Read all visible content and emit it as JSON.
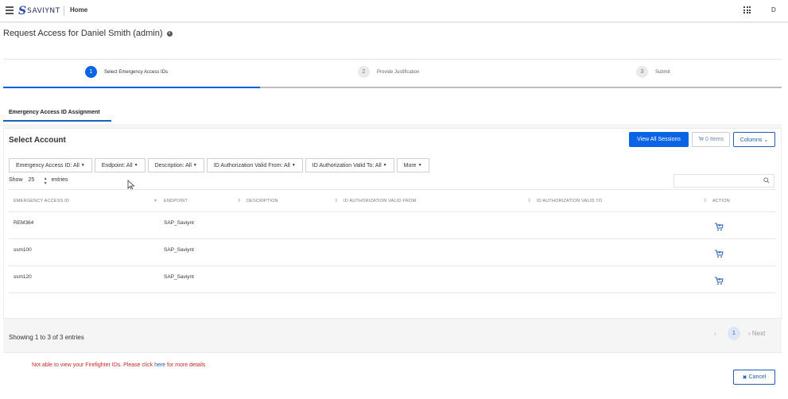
{
  "topbar": {
    "logo_mark": "S",
    "logo_text": "SAVIYNT",
    "home_label": "Home",
    "user_initial": "D"
  },
  "page": {
    "title": "Request Access for Daniel Smith (admin)",
    "info_glyph": "i"
  },
  "steps": [
    {
      "num": "1",
      "label": "Select Emergency Access IDs",
      "active": true
    },
    {
      "num": "2",
      "label": "Provide Justification",
      "active": false
    },
    {
      "num": "3",
      "label": "Submit",
      "active": false
    }
  ],
  "tab": {
    "label": "Emergency Access ID Assignment"
  },
  "panel": {
    "heading": "Select Account",
    "view_sessions_label": "View All Sessions",
    "items_label": "0 Items",
    "columns_label": "Columns ⌄"
  },
  "filters": [
    "Emergency Access ID: All",
    "Endpoint: All",
    "Description: All",
    "ID Authorization Valid From: All",
    "ID Authorization Valid To: All",
    "More"
  ],
  "length_control": {
    "show_label": "Show",
    "value": "25",
    "entries_label": "entries"
  },
  "table": {
    "columns": [
      "EMERGENCY ACCESS ID",
      "ENDPOINT",
      "DESCRIPTION",
      "ID AUTHORIZATION VALID FROM",
      "ID AUTHORIZATION VALID TO",
      "ACTION"
    ],
    "rows": [
      {
        "id": "REM364",
        "endpoint": "SAP_Saviynt"
      },
      {
        "id": "ssm100",
        "endpoint": "SAP_Saviynt"
      },
      {
        "id": "ssm120",
        "endpoint": "SAP_Saviynt"
      }
    ]
  },
  "pagination": {
    "info": "Showing 1 to 3 of 3 entries",
    "prev": "‹",
    "current_page": "1",
    "next": "› Next"
  },
  "footer": {
    "warning_prefix": "Not able to view your Firefighter IDs. Please click ",
    "warning_link": "here",
    "warning_suffix": " for more details",
    "cancel_label": "Cancel"
  },
  "colors": {
    "primary": "#0b63e5",
    "link": "#1f5db4",
    "warning": "#c62828"
  },
  "icons": [
    "menu-icon",
    "apps-grid-icon",
    "info-icon",
    "cart-icon",
    "add-to-cart-icon",
    "search-icon",
    "sort-icon",
    "close-icon"
  ]
}
